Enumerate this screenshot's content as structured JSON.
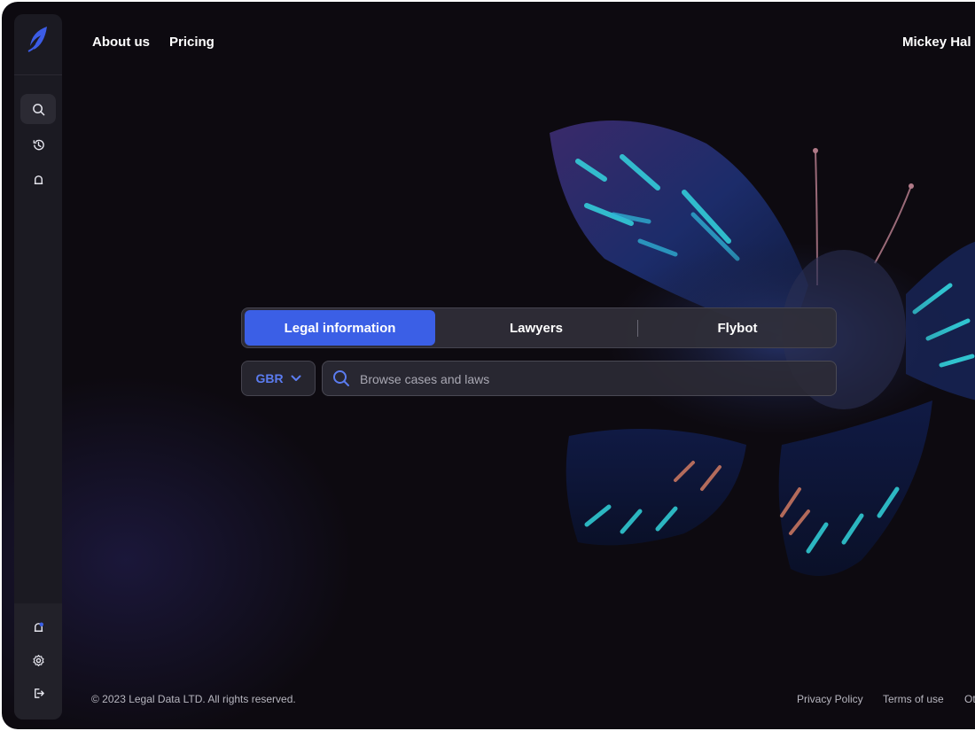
{
  "nav": {
    "about": "About us",
    "pricing": "Pricing",
    "user": "Mickey Hal"
  },
  "sidebar": {
    "items": [
      {
        "icon": "search-icon",
        "active": true
      },
      {
        "icon": "history-icon",
        "active": false
      },
      {
        "icon": "bell-icon",
        "active": false
      }
    ],
    "bottom": [
      {
        "icon": "notification-bell-icon"
      },
      {
        "icon": "settings-gear-icon"
      },
      {
        "icon": "logout-icon"
      }
    ]
  },
  "search_panel": {
    "tabs": [
      {
        "label": "Legal information",
        "active": true
      },
      {
        "label": "Lawyers",
        "active": false
      },
      {
        "label": "Flybot",
        "active": false
      }
    ],
    "country": "GBR",
    "placeholder": "Browse cases and laws"
  },
  "footer": {
    "copyright": "© 2023 Legal Data LTD. All rights reserved.",
    "privacy": "Privacy Policy",
    "terms": "Terms of use",
    "other": "Ot"
  },
  "colors": {
    "background": "#0d0a10",
    "accent": "#3b5fe6",
    "sidebar": "#1b1a22"
  }
}
